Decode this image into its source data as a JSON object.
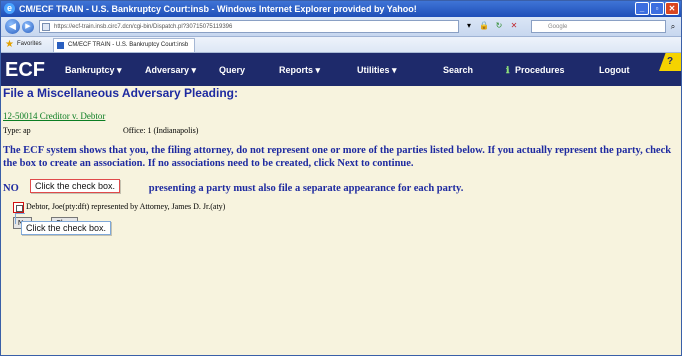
{
  "window": {
    "title": "CM/ECF TRAIN - U.S. Bankruptcy Court:insb - Windows Internet Explorer provided by Yahoo!",
    "controls": [
      "minimize",
      "restore",
      "close"
    ]
  },
  "addressbar": {
    "url": "https://ecf-train.insb.circ7.dcn/cgi-bin/Dispatch.pl?30715075119396",
    "search_placeholder": "Google"
  },
  "favorites": {
    "label": "Favorites",
    "tab_title": "CM/ECF TRAIN - U.S. Bankruptcy Court:insb"
  },
  "ecf": {
    "logo": "ECF",
    "menu": [
      "Bankruptcy",
      "Adversary",
      "Query",
      "Reports",
      "Utilities",
      "Search",
      "Procedures",
      "Logout"
    ]
  },
  "page": {
    "heading": "File a Miscellaneous Adversary Pleading:",
    "case_link": "12-50014 Creditor v. Debtor",
    "type_text": "Type: ap",
    "office_text": "Office: 1 (Indianapolis)",
    "notice": "The ECF system shows that you, the filing attorney, do not represent one or more of the parties listed below. If you actually represent the party, check the box to create an association. If no associations need to be created, click Next to continue.",
    "notice2_prefix": "NO",
    "notice2_rest": "presenting a party must also file a separate appearance for each party.",
    "party": "Debtor, Joe(pty:dft) represented by Attorney, James D. Jr.(aty)",
    "next_label": "Ne",
    "clear_label": "Clear"
  },
  "callouts": {
    "first": "Click the check box.",
    "second": "Click the check box."
  }
}
